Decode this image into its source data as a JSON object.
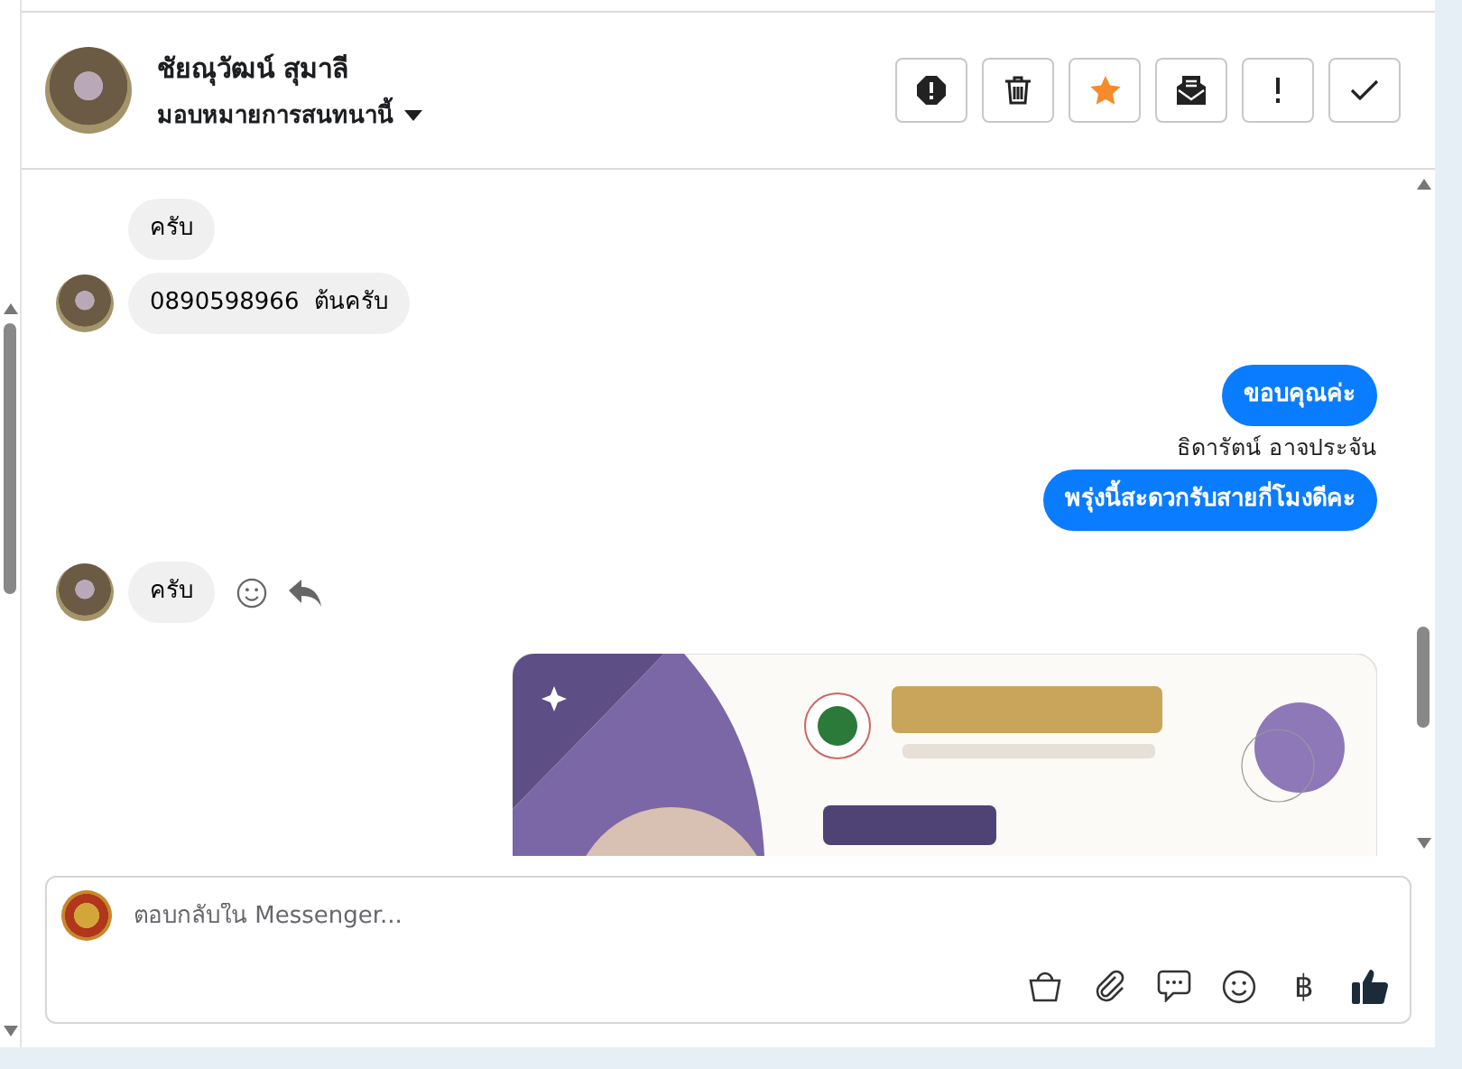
{
  "header": {
    "name": "ชัยณุวัฒน์ สุมาลี",
    "assign_label": "มอบหมายการสนทนานี้",
    "actions": [
      {
        "kind": "spam"
      },
      {
        "kind": "delete"
      },
      {
        "kind": "star"
      },
      {
        "kind": "unread"
      },
      {
        "kind": "important"
      },
      {
        "kind": "done"
      }
    ]
  },
  "messages": [
    {
      "kind": "incoming",
      "text": "ครับ",
      "avatar": false,
      "actions": false
    },
    {
      "kind": "incoming",
      "text": "0890598966  ต้นครับ",
      "avatar": true,
      "actions": false
    },
    {
      "kind": "outgoing",
      "text": "ขอบคุณค่ะ"
    },
    {
      "kind": "sender",
      "text": "ธิดารัตน์ อาจประจัน"
    },
    {
      "kind": "outgoing",
      "text": "พรุ่งนี้สะดวกรับสายกี่โมงดีคะ"
    },
    {
      "kind": "incoming",
      "text": "ครับ",
      "avatar": true,
      "actions": true
    },
    {
      "kind": "image"
    }
  ],
  "composer": {
    "placeholder": "ตอบกลับใน Messenger...",
    "tools": [
      {
        "kind": "bag"
      },
      {
        "kind": "attach"
      },
      {
        "kind": "chat"
      },
      {
        "kind": "emoji"
      },
      {
        "kind": "text",
        "text": "฿"
      },
      {
        "kind": "like"
      }
    ]
  }
}
